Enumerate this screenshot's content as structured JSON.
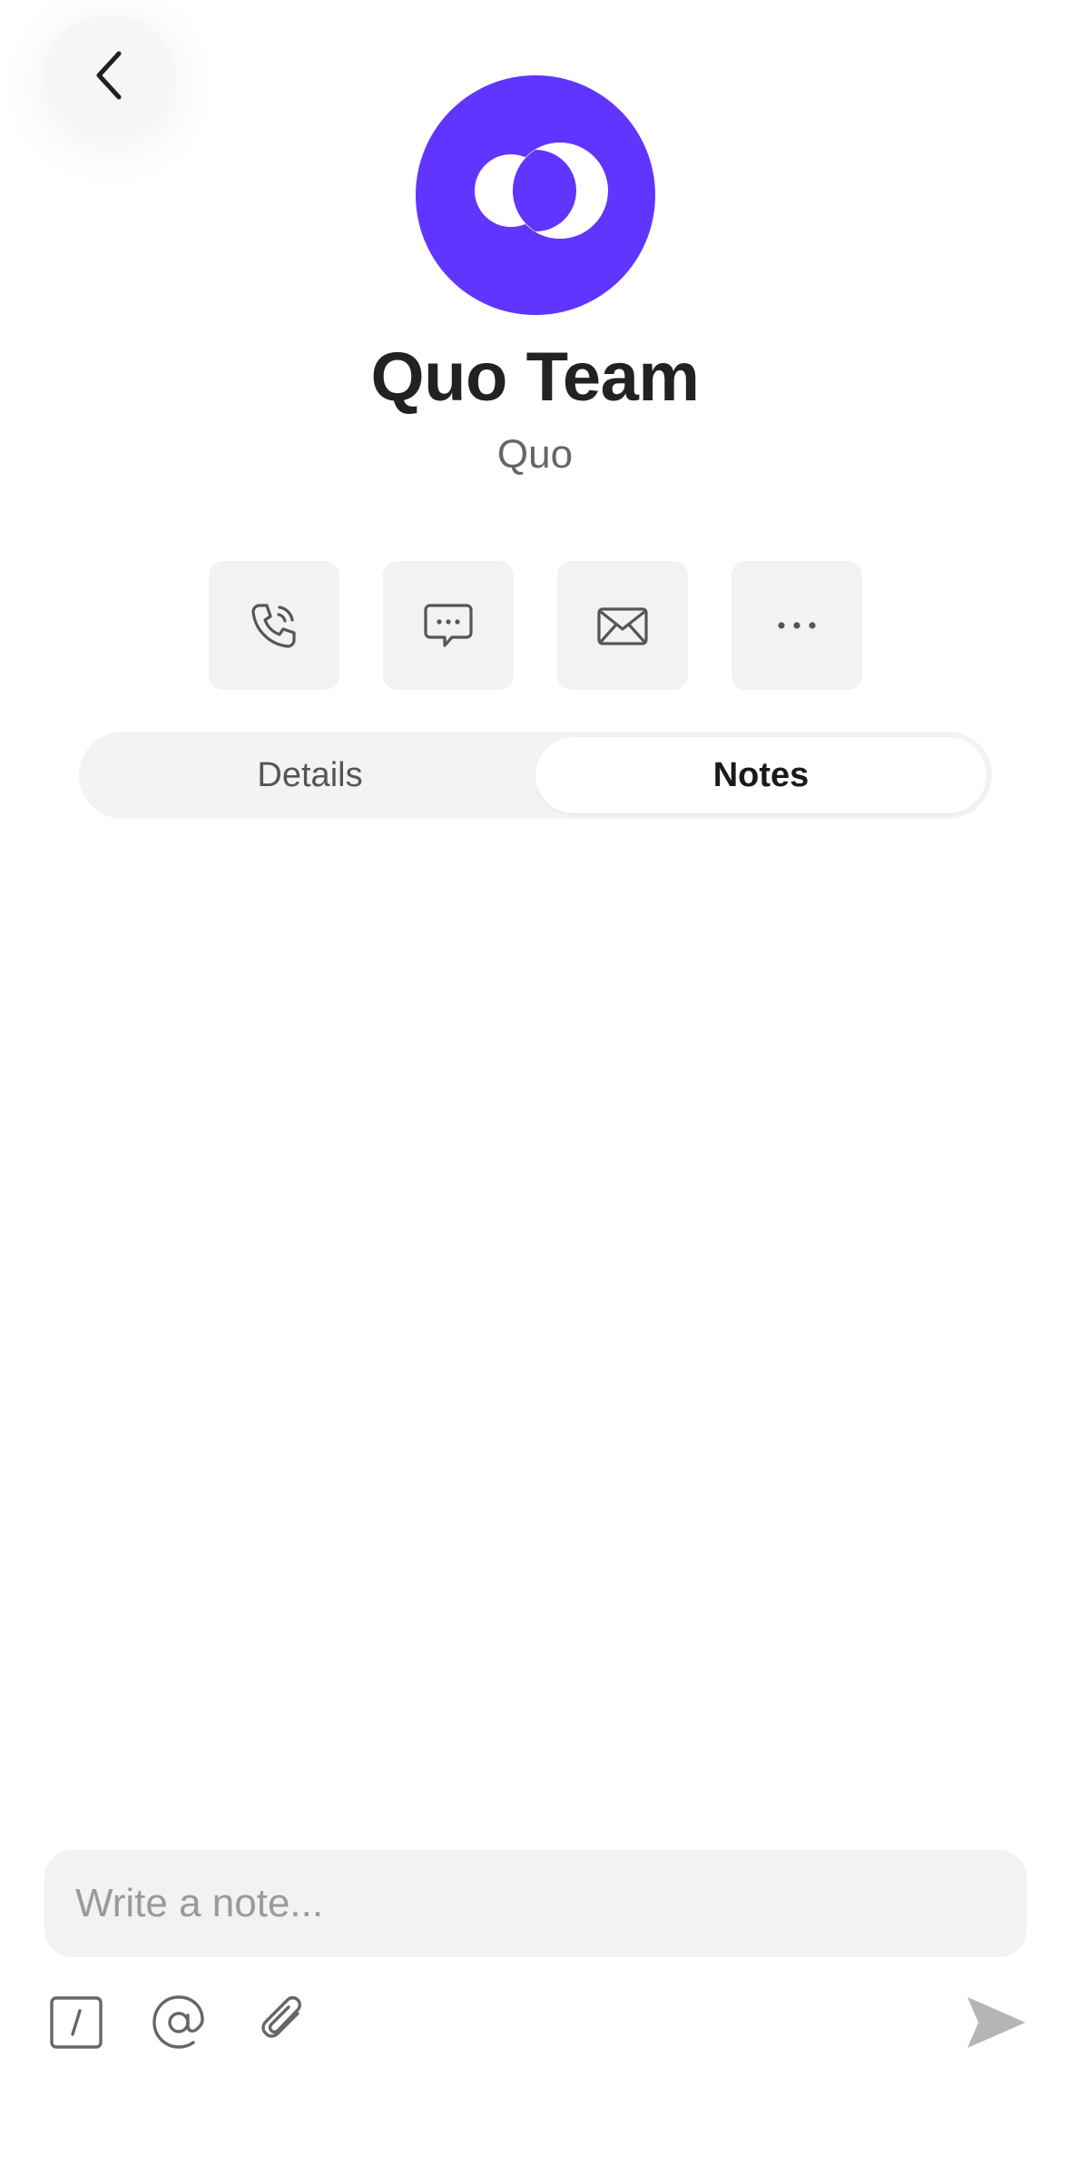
{
  "contact": {
    "name": "Quo Team",
    "company": "Quo"
  },
  "colors": {
    "avatar_bg": "#6035ff",
    "button_bg": "#f2f2f2",
    "icon": "#555555"
  },
  "header": {
    "back_icon": "chevron-left-icon"
  },
  "actions": [
    {
      "icon": "phone-icon"
    },
    {
      "icon": "message-icon"
    },
    {
      "icon": "mail-icon"
    },
    {
      "icon": "more-icon"
    }
  ],
  "tabs": [
    {
      "label": "Details",
      "selected": false
    },
    {
      "label": "Notes",
      "selected": true
    }
  ],
  "composer": {
    "placeholder": "Write a note...",
    "tools": [
      "slash-command-icon",
      "mention-icon",
      "attachment-icon",
      "send-icon"
    ]
  }
}
